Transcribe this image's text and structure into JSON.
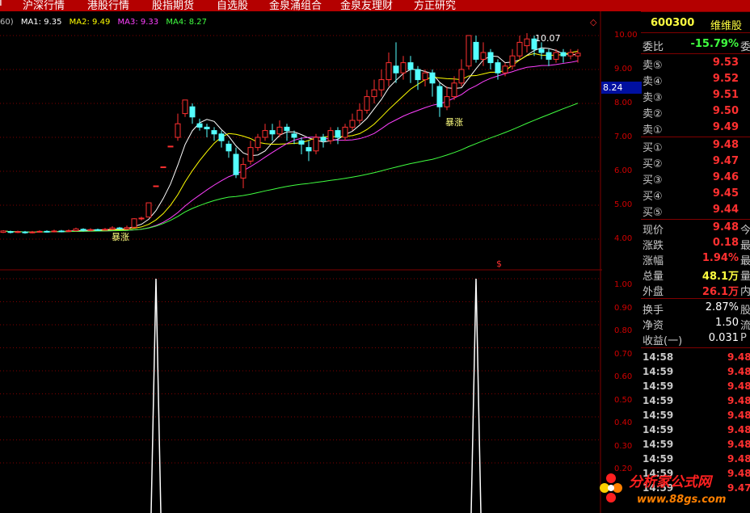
{
  "menu": [
    "沪深行情",
    "港股行情",
    "股指期货",
    "自选股",
    "金泉涌组合",
    "金泉友理财",
    "方正研究"
  ],
  "legend": {
    "prefix": "60)",
    "ma1": "MA1: 9.35",
    "ma2": "MA2: 9.49",
    "ma3": "MA3: 9.33",
    "ma4": "MA4: 8.27"
  },
  "annotations": {
    "high": "10.07",
    "current": "8.24",
    "surge1": "暴涨",
    "surge2": "暴涨",
    "marker": "$"
  },
  "price_axis": [
    "10.00",
    "9.00",
    "8.00",
    "7.00",
    "6.00",
    "5.00",
    "4.00"
  ],
  "indicator_axis": [
    "1.00",
    "0.90",
    "0.80",
    "0.70",
    "0.60",
    "0.50",
    "0.40",
    "0.30",
    "0.20"
  ],
  "quote": {
    "code": "600300",
    "name": "维维股",
    "weibi": {
      "label": "委比",
      "value": "-15.79%",
      "extra": "委"
    },
    "sells": [
      {
        "label": "卖⑤",
        "value": "9.53"
      },
      {
        "label": "卖④",
        "value": "9.52"
      },
      {
        "label": "卖③",
        "value": "9.51"
      },
      {
        "label": "卖②",
        "value": "9.50"
      },
      {
        "label": "卖①",
        "value": "9.49"
      }
    ],
    "buys": [
      {
        "label": "买①",
        "value": "9.48"
      },
      {
        "label": "买②",
        "value": "9.47"
      },
      {
        "label": "买③",
        "value": "9.46"
      },
      {
        "label": "买④",
        "value": "9.45"
      },
      {
        "label": "买⑤",
        "value": "9.44"
      }
    ],
    "stats": [
      {
        "label": "现价",
        "value": "9.48",
        "extra": "今"
      },
      {
        "label": "涨跌",
        "value": "0.18",
        "extra": "最"
      },
      {
        "label": "涨幅",
        "value": "1.94%",
        "extra": "最"
      },
      {
        "label": "总量",
        "value": "48.1万",
        "extra": "量"
      },
      {
        "label": "外盘",
        "value": "26.1万",
        "extra": "内"
      }
    ],
    "info": [
      {
        "label": "换手",
        "value": "2.87%",
        "extra": "股"
      },
      {
        "label": "净资",
        "value": "1.50",
        "extra": "流"
      },
      {
        "label": "收益(一)",
        "value": "0.031",
        "extra": "P"
      }
    ],
    "ticks": [
      {
        "time": "14:58",
        "price": "9.48"
      },
      {
        "time": "14:59",
        "price": "9.48"
      },
      {
        "time": "14:59",
        "price": "9.48"
      },
      {
        "time": "14:59",
        "price": "9.48"
      },
      {
        "time": "14:59",
        "price": "9.48"
      },
      {
        "time": "14:59",
        "price": "9.48"
      },
      {
        "time": "14:59",
        "price": "9.48"
      },
      {
        "time": "14:59",
        "price": "9.48"
      },
      {
        "time": "14:59",
        "price": "9.48"
      },
      {
        "time": "14:59",
        "price": "9.47"
      }
    ]
  },
  "watermark": {
    "text": "分析家公式网",
    "url": "www.88gs.com"
  },
  "colors": {
    "up": "#ff3030",
    "down": "#54ffff",
    "ma1": "#ffffff",
    "ma2": "#ffff00",
    "ma3": "#ff40ff",
    "ma4": "#40ff40",
    "grid": "#800000"
  },
  "chart_data": {
    "type": "candlestick",
    "price_range": [
      3.6,
      10.4
    ],
    "candles": [
      [
        4.2,
        4.24,
        4.18,
        4.26
      ],
      [
        4.22,
        4.2,
        4.17,
        4.25
      ],
      [
        4.2,
        4.22,
        4.18,
        4.25
      ],
      [
        4.21,
        4.19,
        4.16,
        4.24
      ],
      [
        4.19,
        4.21,
        4.17,
        4.24
      ],
      [
        4.21,
        4.23,
        4.19,
        4.26
      ],
      [
        4.23,
        4.22,
        4.19,
        4.26
      ],
      [
        4.22,
        4.24,
        4.2,
        4.28
      ],
      [
        4.24,
        4.23,
        4.2,
        4.27
      ],
      [
        4.23,
        4.25,
        4.21,
        4.29
      ],
      [
        4.25,
        4.3,
        4.22,
        4.34
      ],
      [
        4.29,
        4.26,
        4.23,
        4.32
      ],
      [
        4.26,
        4.28,
        4.23,
        4.32
      ],
      [
        4.28,
        4.27,
        4.24,
        4.31
      ],
      [
        4.27,
        4.29,
        4.25,
        4.33
      ],
      [
        4.29,
        4.33,
        4.27,
        4.38
      ],
      [
        4.33,
        4.3,
        4.27,
        4.36
      ],
      [
        4.3,
        4.34,
        4.28,
        4.4
      ],
      [
        4.35,
        4.6,
        4.33,
        4.62
      ],
      [
        4.6,
        4.62,
        4.55,
        4.66
      ],
      [
        4.65,
        5.07,
        5.07,
        5.07
      ],
      [
        5.57,
        5.57,
        5.57,
        5.57
      ],
      [
        6.13,
        6.13,
        6.13,
        6.13
      ],
      [
        6.74,
        6.74,
        6.74,
        6.74
      ],
      [
        7.0,
        7.4,
        6.9,
        7.7
      ],
      [
        7.7,
        8.1,
        7.6,
        8.1
      ],
      [
        7.9,
        7.6,
        7.4,
        8.0
      ],
      [
        7.4,
        7.3,
        7.2,
        7.55
      ],
      [
        7.3,
        7.25,
        7.0,
        7.4
      ],
      [
        7.2,
        7.1,
        6.9,
        7.3
      ],
      [
        7.1,
        6.9,
        6.7,
        7.2
      ],
      [
        6.8,
        6.6,
        6.4,
        6.9
      ],
      [
        6.5,
        5.9,
        5.8,
        6.7
      ],
      [
        5.8,
        6.2,
        5.5,
        6.4
      ],
      [
        6.3,
        6.7,
        6.2,
        6.9
      ],
      [
        6.7,
        7.0,
        6.6,
        7.1
      ],
      [
        7.0,
        7.2,
        6.9,
        7.4
      ],
      [
        7.2,
        7.1,
        6.9,
        7.4
      ],
      [
        7.1,
        7.3,
        7.0,
        7.5
      ],
      [
        7.3,
        7.2,
        6.9,
        7.4
      ],
      [
        7.1,
        7.0,
        6.8,
        7.2
      ],
      [
        6.9,
        6.8,
        6.5,
        7.0
      ],
      [
        6.7,
        6.6,
        6.3,
        6.9
      ],
      [
        6.6,
        7.0,
        6.5,
        7.1
      ],
      [
        7.0,
        6.9,
        6.7,
        7.1
      ],
      [
        6.9,
        7.2,
        6.8,
        7.3
      ],
      [
        7.2,
        7.0,
        6.8,
        7.3
      ],
      [
        7.0,
        7.3,
        6.9,
        7.4
      ],
      [
        7.3,
        7.5,
        7.2,
        7.7
      ],
      [
        7.5,
        7.8,
        7.4,
        8.0
      ],
      [
        7.8,
        8.2,
        7.7,
        8.4
      ],
      [
        8.2,
        8.4,
        8.0,
        8.7
      ],
      [
        8.4,
        8.7,
        8.2,
        9.0
      ],
      [
        8.7,
        9.2,
        8.5,
        9.5
      ],
      [
        9.1,
        8.9,
        8.6,
        9.8
      ],
      [
        8.9,
        9.2,
        8.7,
        9.4
      ],
      [
        9.2,
        9.0,
        8.6,
        9.4
      ],
      [
        9.0,
        8.7,
        8.4,
        9.1
      ],
      [
        8.7,
        8.9,
        8.5,
        9.0
      ],
      [
        8.9,
        8.6,
        8.2,
        9.0
      ],
      [
        8.5,
        7.9,
        7.6,
        8.6
      ],
      [
        7.9,
        8.2,
        7.8,
        8.5
      ],
      [
        8.2,
        8.6,
        8.1,
        8.8
      ],
      [
        8.6,
        9.0,
        8.5,
        9.3
      ],
      [
        9.1,
        10.0,
        9.0,
        10.0
      ],
      [
        9.8,
        9.3,
        9.2,
        10.0
      ],
      [
        9.3,
        9.5,
        9.1,
        9.8
      ],
      [
        9.5,
        9.2,
        9.0,
        9.6
      ],
      [
        9.2,
        8.9,
        8.7,
        9.3
      ],
      [
        8.9,
        9.1,
        8.8,
        9.2
      ],
      [
        9.1,
        9.4,
        9.0,
        9.6
      ],
      [
        9.4,
        9.8,
        9.3,
        10.0
      ],
      [
        9.7,
        9.9,
        9.5,
        10.07
      ],
      [
        9.9,
        9.6,
        9.4,
        10.0
      ],
      [
        9.6,
        9.5,
        9.3,
        9.8
      ],
      [
        9.5,
        9.3,
        9.1,
        9.6
      ],
      [
        9.3,
        9.5,
        9.2,
        9.6
      ],
      [
        9.5,
        9.4,
        9.2,
        9.6
      ],
      [
        9.4,
        9.5,
        9.3,
        9.6
      ],
      [
        9.4,
        9.48,
        9.2,
        9.6
      ]
    ],
    "indicator_range": [
      0,
      1
    ],
    "indicator_spikes": [
      21,
      65
    ]
  }
}
